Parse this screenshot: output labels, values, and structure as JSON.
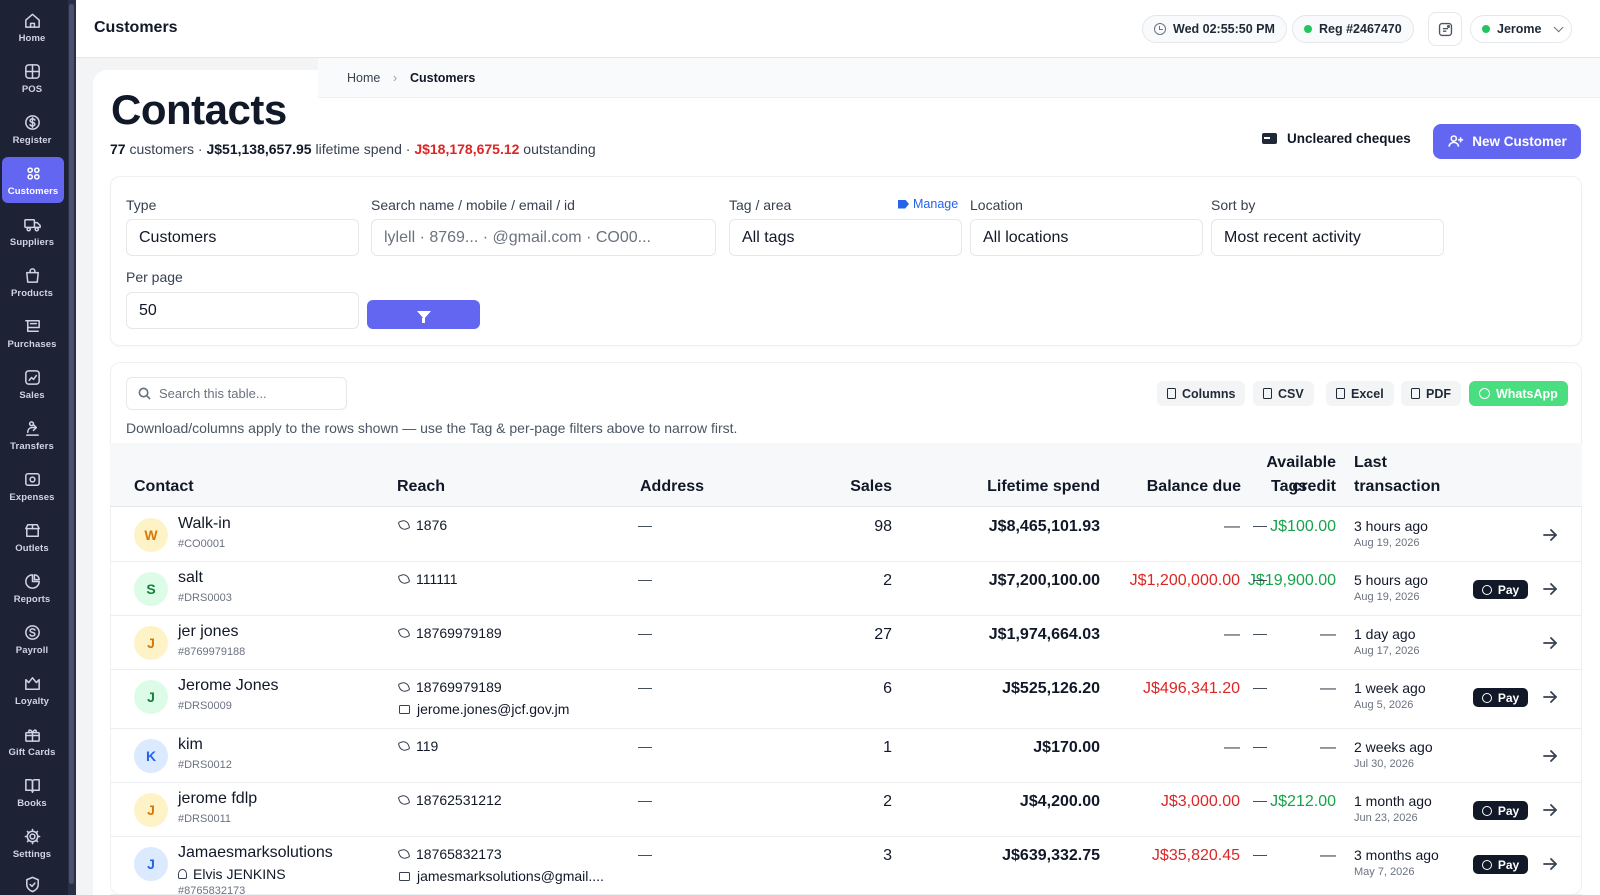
{
  "sidebar": {
    "items": [
      {
        "label": "Home",
        "icon": "home-icon"
      },
      {
        "label": "POS",
        "icon": "pos-icon"
      },
      {
        "label": "Register",
        "icon": "dollar-icon"
      },
      {
        "label": "Customers",
        "icon": "customers-icon",
        "active": true
      },
      {
        "label": "Suppliers",
        "icon": "truck-icon"
      },
      {
        "label": "Products",
        "icon": "bag-icon"
      },
      {
        "label": "Purchases",
        "icon": "cart-icon"
      },
      {
        "label": "Sales",
        "icon": "chart-icon"
      },
      {
        "label": "Transfers",
        "icon": "transfer-icon"
      },
      {
        "label": "Expenses",
        "icon": "expense-icon"
      },
      {
        "label": "Outlets",
        "icon": "store-icon"
      },
      {
        "label": "Reports",
        "icon": "pie-icon"
      },
      {
        "label": "Payroll",
        "icon": "payroll-icon"
      },
      {
        "label": "Loyalty",
        "icon": "loyalty-icon"
      },
      {
        "label": "Gift Cards",
        "icon": "gift-icon"
      },
      {
        "label": "Books",
        "icon": "book-icon"
      },
      {
        "label": "Settings",
        "icon": "gear-icon"
      }
    ]
  },
  "topbar": {
    "title": "Customers",
    "clock": "Wed 02:55:50 PM",
    "register": "Reg #2467470",
    "user": "Jerome"
  },
  "breadcrumb": {
    "home": "Home",
    "sep": "›",
    "current": "Customers"
  },
  "page": {
    "title": "Contacts",
    "summary": {
      "count": "77",
      "count_label": " customers · ",
      "lifetime": "J$51,138,657.95",
      "lifetime_label": " lifetime spend · ",
      "outstanding": "J$18,178,675.12",
      "outstanding_label": " outstanding"
    },
    "uncleared_label": "Uncleared cheques",
    "new_customer_label": "New Customer"
  },
  "filters": {
    "type_label": "Type",
    "type_value": "Customers",
    "search_label": "Search name / mobile / email / id",
    "search_placeholder": "lylell · 8769... · @gmail.com · CO00...",
    "tag_label": "Tag / area",
    "manage_label": "Manage",
    "tag_value": "All tags",
    "location_label": "Location",
    "location_value": "All locations",
    "sort_label": "Sort by",
    "sort_value": "Most recent activity",
    "perpage_label": "Per page",
    "perpage_value": "50"
  },
  "table": {
    "search_placeholder": "Search this table...",
    "tools": [
      "Columns",
      "CSV",
      "Excel",
      "PDF",
      "WhatsApp"
    ],
    "hint": "Download/columns apply to the rows shown — use the Tag & per-page filters above to narrow first.",
    "headers": {
      "contact": "Contact",
      "reach": "Reach",
      "address": "Address",
      "sales": "Sales",
      "lifetime": "Lifetime spend",
      "balance": "Balance due",
      "credit_1": "Available",
      "credit_2": "credit",
      "tags": "Tags",
      "last_1": "Last",
      "last_2": "transaction"
    },
    "pay_label": "Pay",
    "dash": "—",
    "rows": [
      {
        "initial": "W",
        "name": "Walk-in",
        "id": "#CO0001",
        "phone": "1876",
        "email": "",
        "contact_person": "",
        "address": "—",
        "sales": "98",
        "lifetime": "J$8,465,101.93",
        "balance": "—",
        "credit": "J$100.00",
        "tags": "—",
        "ago": "3 hours ago",
        "date": "Aug 19, 2026",
        "pay": false
      },
      {
        "initial": "S",
        "name": "salt",
        "id": "#DRS0003",
        "phone": "111111",
        "email": "",
        "contact_person": "",
        "address": "—",
        "sales": "2",
        "lifetime": "J$7,200,100.00",
        "balance": "J$1,200,000.00",
        "credit": "J$19,900.00",
        "tags": "—",
        "ago": "5 hours ago",
        "date": "Aug 19, 2026",
        "pay": true
      },
      {
        "initial": "J",
        "name": "jer jones",
        "id": "#8769979188",
        "phone": "18769979189",
        "email": "",
        "contact_person": "",
        "address": "—",
        "sales": "27",
        "lifetime": "J$1,974,664.03",
        "balance": "—",
        "credit": "—",
        "tags": "—",
        "ago": "1 day ago",
        "date": "Aug 17, 2026",
        "pay": false
      },
      {
        "initial": "J",
        "name": "Jerome Jones",
        "id": "#DRS0009",
        "phone": "18769979189",
        "email": "jerome.jones@jcf.gov.jm",
        "contact_person": "",
        "address": "—",
        "sales": "6",
        "lifetime": "J$525,126.20",
        "balance": "J$496,341.20",
        "credit": "—",
        "tags": "—",
        "ago": "1 week ago",
        "date": "Aug 5, 2026",
        "pay": true
      },
      {
        "initial": "K",
        "name": "kim",
        "id": "#DRS0012",
        "phone": "119",
        "email": "",
        "contact_person": "",
        "address": "—",
        "sales": "1",
        "lifetime": "J$170.00",
        "balance": "—",
        "credit": "—",
        "tags": "—",
        "ago": "2 weeks ago",
        "date": "Jul 30, 2026",
        "pay": false
      },
      {
        "initial": "J",
        "name": "jerome fdlp",
        "id": "#DRS0011",
        "phone": "18762531212",
        "email": "",
        "contact_person": "",
        "address": "—",
        "sales": "2",
        "lifetime": "J$4,200.00",
        "balance": "J$3,000.00",
        "credit": "J$212.00",
        "tags": "—",
        "ago": "1 month ago",
        "date": "Jun 23, 2026",
        "pay": true
      },
      {
        "initial": "J",
        "name": "Jamaesmarksolutions",
        "id": "#8765832173",
        "phone": "18765832173",
        "email": "jamesmarksolutions@gmail....",
        "contact_person": "Elvis JENKINS",
        "address": "—",
        "sales": "3",
        "lifetime": "J$639,332.75",
        "balance": "J$35,820.45",
        "credit": "—",
        "tags": "—",
        "ago": "3 months ago",
        "date": "May 7, 2026",
        "pay": true
      }
    ]
  },
  "colors": {
    "accent": "#6366f1",
    "sidebar": "#1e2235",
    "danger": "#dc2626",
    "success": "#16a34a",
    "whatsapp": "#4ade80"
  }
}
